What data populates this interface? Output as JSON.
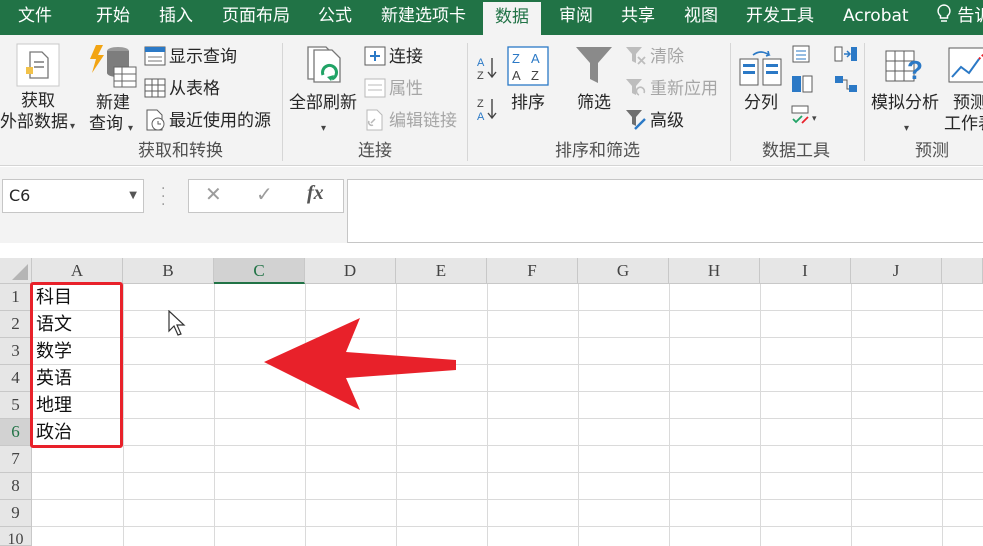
{
  "tabs": [
    {
      "label": "文件"
    },
    {
      "label": "开始"
    },
    {
      "label": "插入"
    },
    {
      "label": "页面布局"
    },
    {
      "label": "公式"
    },
    {
      "label": "新建选项卡"
    },
    {
      "label": "数据"
    },
    {
      "label": "审阅"
    },
    {
      "label": "共享"
    },
    {
      "label": "视图"
    },
    {
      "label": "开发工具"
    },
    {
      "label": "Acrobat"
    }
  ],
  "active_tab": "数据",
  "tell_me": "告诉",
  "ribbon": {
    "get_transform": {
      "get_external": [
        "获取",
        "外部数据"
      ],
      "new_query": [
        "新建",
        "查询"
      ],
      "show_queries": "显示查询",
      "from_table": "从表格",
      "recent_sources": "最近使用的源",
      "group_label": "获取和转换"
    },
    "connections": {
      "refresh_all": "全部刷新",
      "connections": "连接",
      "properties": "属性",
      "edit_links": "编辑链接",
      "group_label": "连接"
    },
    "sort_filter": {
      "sort": "排序",
      "filter": "筛选",
      "clear": "清除",
      "reapply": "重新应用",
      "advanced": "高级",
      "group_label": "排序和筛选"
    },
    "data_tools": {
      "text_to_columns": "分列",
      "group_label": "数据工具"
    },
    "forecast": {
      "what_if": "模拟分析",
      "forecast_sheet": [
        "预测",
        "工作表"
      ],
      "group_label": "预测"
    }
  },
  "formula_bar": {
    "name_box": "C6",
    "fx": "fx",
    "formula": ""
  },
  "sheet": {
    "columns": [
      "A",
      "B",
      "C",
      "D",
      "E",
      "F",
      "G",
      "H",
      "I",
      "J"
    ],
    "selected_column": "C",
    "rows": [
      "1",
      "2",
      "3",
      "4",
      "5",
      "6",
      "7",
      "8",
      "9",
      "10"
    ],
    "selected_row": "6",
    "column_a": [
      "科目",
      "语文",
      "数学",
      "英语",
      "地理",
      "政治"
    ]
  },
  "colors": {
    "accent": "#217346",
    "highlight_box": "#e8212a",
    "arrow": "#e8212a"
  }
}
